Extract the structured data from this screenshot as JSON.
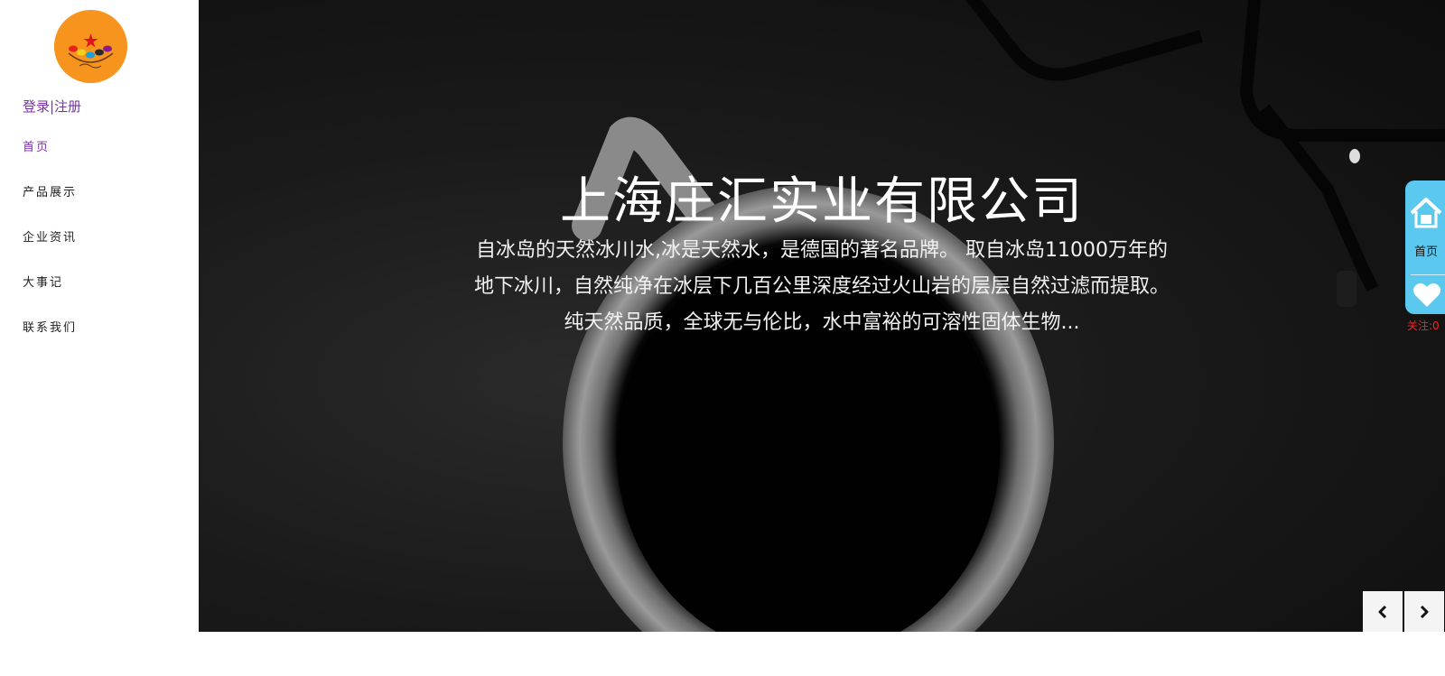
{
  "sidebar": {
    "auth_link": "登录|注册",
    "nav": [
      {
        "label": "首页",
        "active": true
      },
      {
        "label": "产品展示",
        "active": false
      },
      {
        "label": "企业资讯",
        "active": false
      },
      {
        "label": "大事记",
        "active": false
      },
      {
        "label": "联系我们",
        "active": false
      }
    ]
  },
  "hero": {
    "title": "上海庄汇实业有限公司",
    "description": "自冰岛的天然冰川水,冰是天然水，是德国的著名品牌。 取自冰岛11000万年的地下冰川，自然纯净在冰层下几百公里深度经过火山岩的层层自然过滤而提取。 纯天然品质，全球无与伦比，水中富裕的可溶性固体生物..."
  },
  "float_widget": {
    "home_label": "首页",
    "follow_label": "关注:0"
  },
  "icons": {
    "logo": "orange-circle-logo",
    "home": "house-icon",
    "like": "heart-icon",
    "prev": "chevron-left-icon",
    "next": "chevron-right-icon"
  },
  "colors": {
    "accent_purple": "#7b2fa8",
    "logo_orange": "#f7941d",
    "float_blue": "#5bc8ef",
    "follow_red": "#ff2020"
  }
}
